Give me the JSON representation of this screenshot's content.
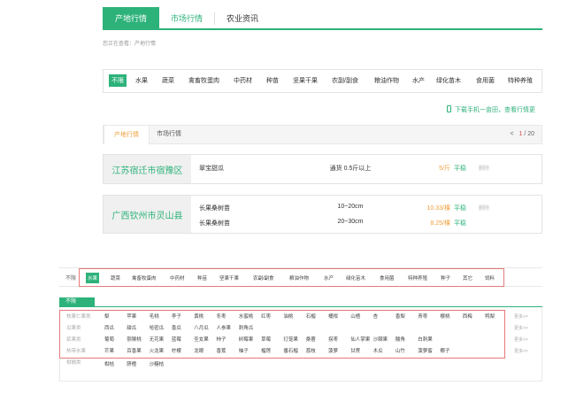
{
  "top_nav": {
    "tabs": [
      "产地行情",
      "市场行情",
      "农业资讯"
    ]
  },
  "breadcrumb": "您正在查看：产地行情",
  "categories": [
    "不限",
    "水果",
    "蔬菜",
    "禽畜牧蛋肉",
    "中药材",
    "种苗",
    "坚果干果",
    "农副/副食",
    "粮油作物",
    "水产",
    "绿化苗木",
    "食用菌",
    "特种养殖"
  ],
  "download_text": "下载手机一亩田，查看行情更",
  "tabs": [
    "产地行情",
    "市场行情"
  ],
  "pager": {
    "prev": "<",
    "current": "1",
    "total": "/ 20"
  },
  "records": [
    {
      "place": "江苏宿迁市宿豫区",
      "items": [
        {
          "product": "翠宝甜瓜",
          "spec": "通货 0.5斤以上",
          "price": "5/斤",
          "trend": "平稳",
          "stamp": "删除"
        }
      ]
    },
    {
      "place": "广西钦州市灵山县",
      "items": [
        {
          "product": "长果桑树苗",
          "spec": "10~20cm",
          "price": "10.33/棵",
          "trend": "平稳",
          "stamp": "删除"
        },
        {
          "product": "长果桑树苗",
          "spec": "20~30cm",
          "price": "8.25/棵",
          "trend": "平稳",
          "stamp": ""
        }
      ]
    }
  ],
  "lower_bar": {
    "label": "不限",
    "items": [
      "水果",
      "蔬菜",
      "禽畜牧蛋肉",
      "中药材",
      "种苗",
      "坚果干果",
      "农副/副食",
      "粮油作物",
      "水产",
      "绿化苗木",
      "食用菌",
      "特种养殖",
      "种子",
      "其它",
      "饲料"
    ]
  },
  "lower_tab": "不限",
  "subcats": [
    "核果仁果类",
    "瓜果类",
    "浆果类",
    "热带水果",
    "柑橘类"
  ],
  "fruit_rows": [
    [
      "梨",
      "苹果",
      "毛桃",
      "李子",
      "黄桃",
      "冬枣",
      "水蜜桃",
      "红枣",
      "油桃",
      "石榴",
      "桶柑",
      "山楂",
      "杏",
      "香梨",
      "青枣",
      "樱桃",
      "西梅",
      "鸭梨"
    ],
    [
      "西瓜",
      "甜瓜",
      "哈密瓜",
      "香瓜",
      "八月瓜",
      "人参果",
      "刺角瓜"
    ],
    [
      "葡萄",
      "猕猴桃",
      "无花果",
      "蓝莓",
      "圣女果",
      "柿子",
      "树莓果",
      "草莓",
      "灯笼果",
      "桑葚",
      "拐枣",
      "仙人掌果",
      "沙棘果",
      "酸角",
      "白刺果"
    ],
    [
      "芒果",
      "百香果",
      "火龙果",
      "柠檬",
      "龙眼",
      "香蕉",
      "柚子",
      "榴莲",
      "番石榴",
      "荔枝",
      "菠萝",
      "甘蔗",
      "木瓜",
      "山竹",
      "菠萝蜜",
      "椰子"
    ],
    [
      "柑桔",
      "脐橙",
      "沙糖桔"
    ]
  ],
  "more_label": "更多>>"
}
